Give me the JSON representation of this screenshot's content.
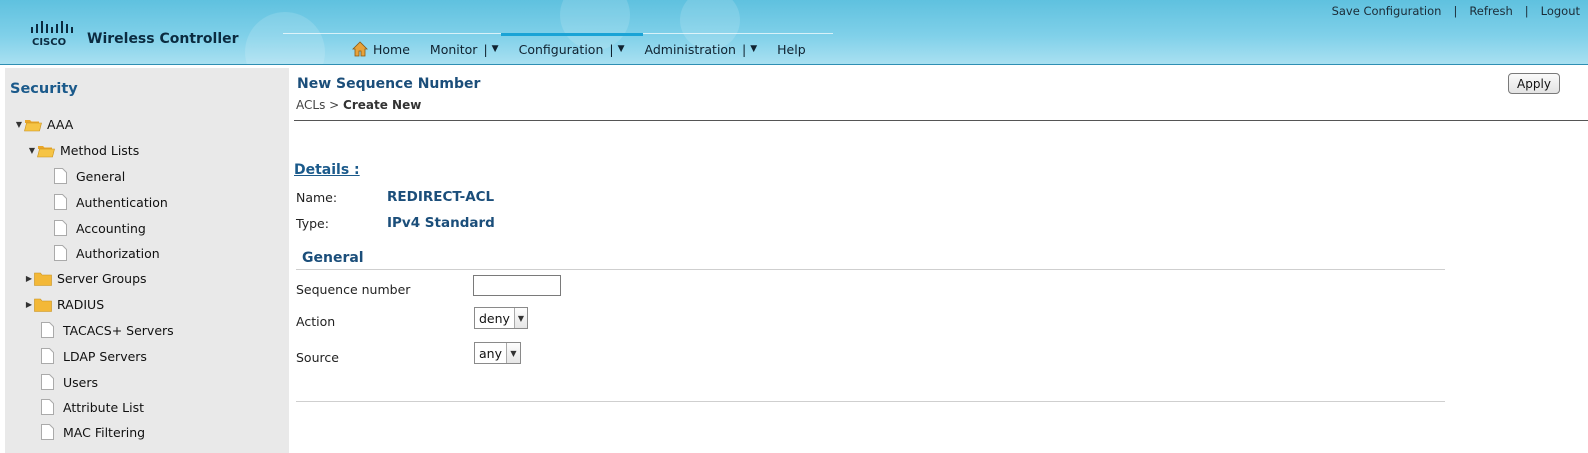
{
  "header": {
    "brand": "CISCO",
    "product": "Wireless Controller",
    "util_links": [
      "Save Configuration",
      "Refresh",
      "Logout"
    ],
    "util_sep": "|",
    "nav": [
      {
        "label": "Home"
      },
      {
        "label": "Monitor",
        "dropdown": true
      },
      {
        "label": "Configuration",
        "dropdown": true,
        "active": true
      },
      {
        "label": "Administration",
        "dropdown": true
      },
      {
        "label": "Help"
      }
    ],
    "nav_sep": "|",
    "nav_arrow": "▼"
  },
  "sidebar": {
    "title": "Security",
    "items": [
      {
        "label": "AAA",
        "type": "folder",
        "state": "expanded"
      },
      {
        "label": "Method Lists",
        "type": "folder",
        "state": "expanded"
      },
      {
        "label": "General",
        "type": "page"
      },
      {
        "label": "Authentication",
        "type": "page"
      },
      {
        "label": "Accounting",
        "type": "page"
      },
      {
        "label": "Authorization",
        "type": "page"
      },
      {
        "label": "Server Groups",
        "type": "folder",
        "state": "collapsed"
      },
      {
        "label": "RADIUS",
        "type": "folder",
        "state": "collapsed"
      },
      {
        "label": "TACACS+ Servers",
        "type": "page"
      },
      {
        "label": "LDAP Servers",
        "type": "page"
      },
      {
        "label": "Users",
        "type": "page"
      },
      {
        "label": "Attribute List",
        "type": "page"
      },
      {
        "label": "MAC Filtering",
        "type": "page"
      }
    ]
  },
  "main": {
    "title": "New Sequence Number",
    "breadcrumb": {
      "parent": "ACLs",
      "separator": ">",
      "current": "Create New"
    },
    "apply_label": "Apply",
    "details_heading": "Details :",
    "name_label": "Name:",
    "name_value": "REDIRECT-ACL",
    "type_label": "Type:",
    "type_value": "IPv4 Standard",
    "section_heading": "General",
    "fields": {
      "sequence_label": "Sequence number",
      "sequence_value": "",
      "action_label": "Action",
      "action_value": "deny",
      "source_label": "Source",
      "source_value": "any"
    }
  },
  "colors": {
    "header_top": "#5fc1df",
    "header_bottom": "#a9e0f1",
    "title_blue": "#1b4e7a",
    "sidebar_bg": "#e9e9e9"
  },
  "icons": {
    "home": "home-icon",
    "folder": "folder-icon",
    "page": "page-icon",
    "dropdown": "chevron-down-icon"
  }
}
